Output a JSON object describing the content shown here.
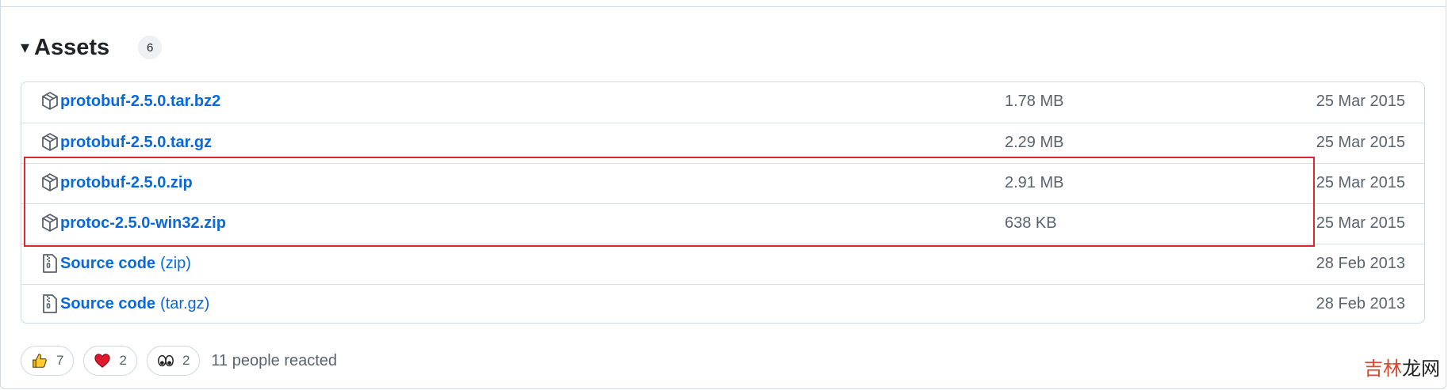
{
  "assets": {
    "title": "Assets",
    "count": "6",
    "rows": [
      {
        "name": "protobuf-2.5.0.tar.bz2",
        "suffix": "",
        "size": "1.78 MB",
        "date": "25 Mar 2015",
        "icon": "package-icon"
      },
      {
        "name": "protobuf-2.5.0.tar.gz",
        "suffix": "",
        "size": "2.29 MB",
        "date": "25 Mar 2015",
        "icon": "package-icon"
      },
      {
        "name": "protobuf-2.5.0.zip",
        "suffix": "",
        "size": "2.91 MB",
        "date": "25 Mar 2015",
        "icon": "package-icon"
      },
      {
        "name": "protoc-2.5.0-win32.zip",
        "suffix": "",
        "size": "638 KB",
        "date": "25 Mar 2015",
        "icon": "package-icon"
      },
      {
        "name": "Source code",
        "suffix": "(zip)",
        "size": "",
        "date": "28 Feb 2013",
        "icon": "file-zip-icon"
      },
      {
        "name": "Source code",
        "suffix": "(tar.gz)",
        "size": "",
        "date": "28 Feb 2013",
        "icon": "file-zip-icon"
      }
    ]
  },
  "reactions": {
    "items": [
      {
        "emoji": "thumbs-up-icon",
        "count": "7"
      },
      {
        "emoji": "heart-icon",
        "count": "2"
      },
      {
        "emoji": "eyes-icon",
        "count": "2"
      }
    ],
    "summary": "11 people reacted"
  },
  "watermark": {
    "part1": "吉林",
    "part2": "龙网"
  },
  "colors": {
    "link": "#0969da",
    "highlight": "#e0272e",
    "muted": "#59636e",
    "border": "#d0d7de"
  }
}
